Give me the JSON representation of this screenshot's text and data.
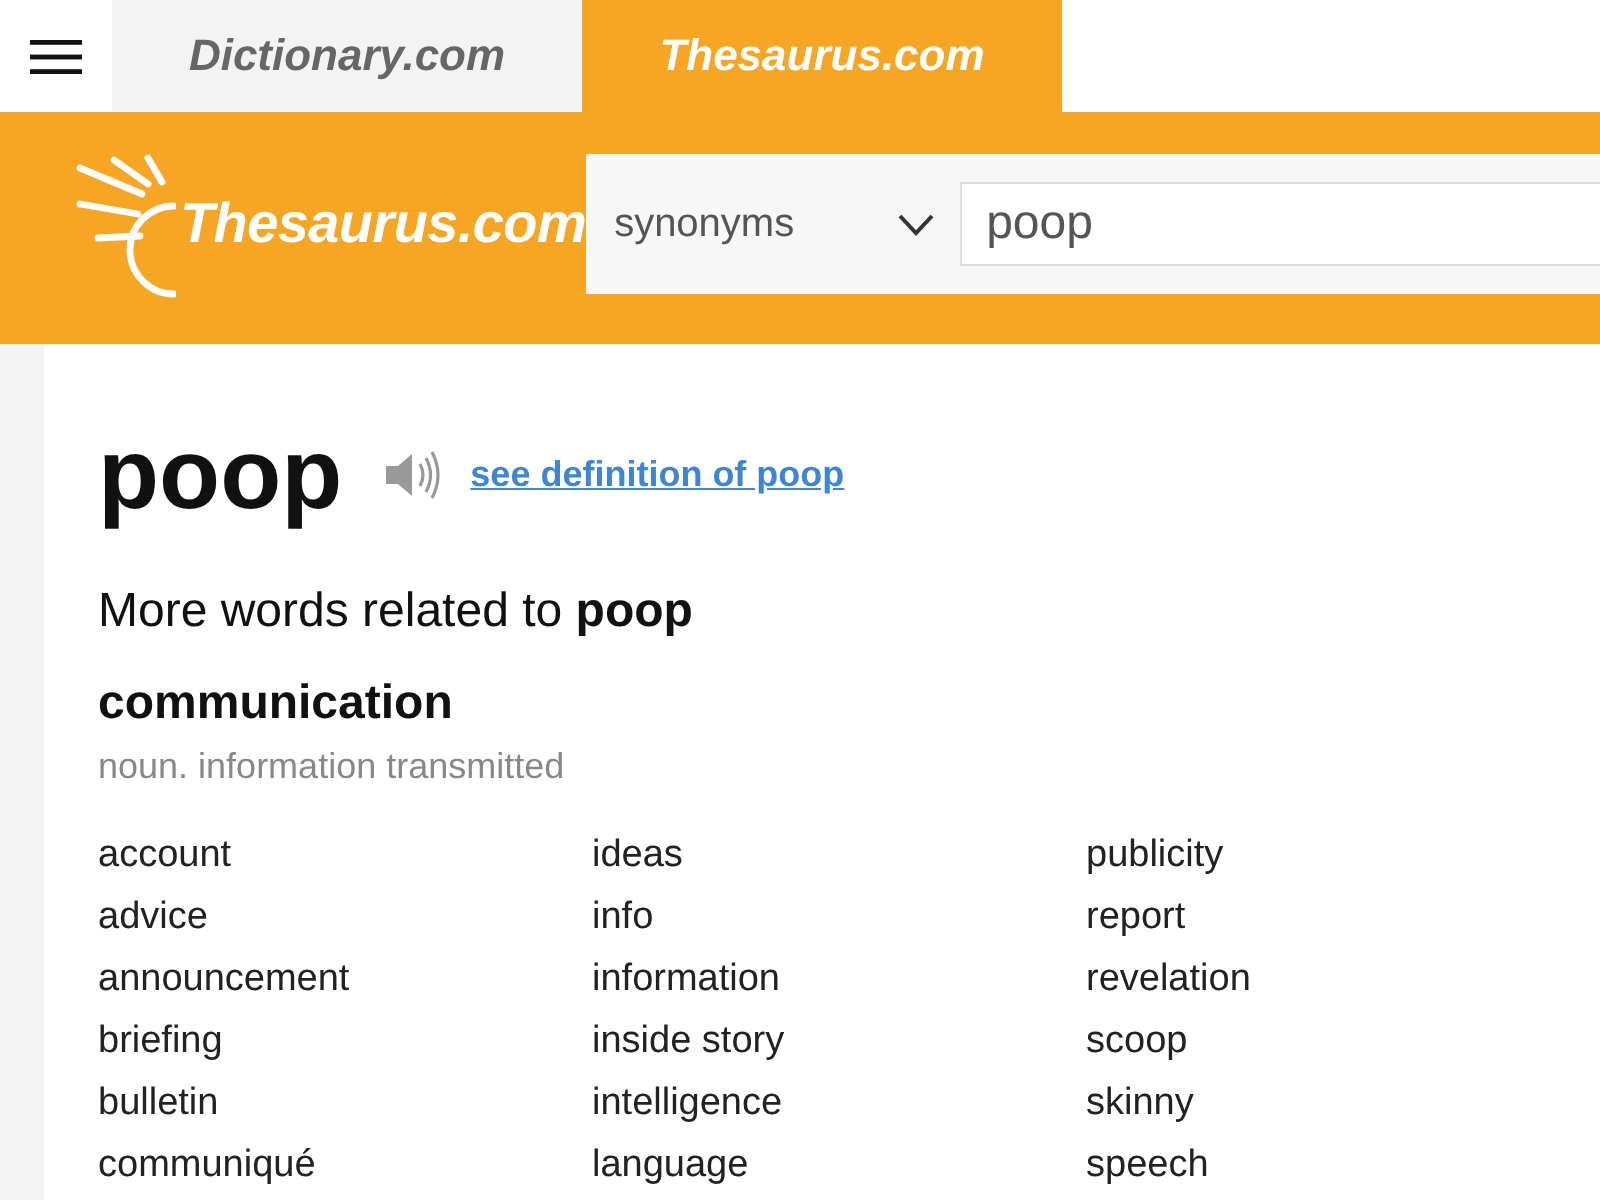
{
  "top_nav": {
    "tabs": [
      {
        "label": "Dictionary.com",
        "selected": false
      },
      {
        "label": "Thesaurus.com",
        "selected": true
      }
    ]
  },
  "header": {
    "logo": "Thesaurus.com",
    "search": {
      "mode": "synonyms",
      "value": "poop"
    }
  },
  "entry": {
    "word": "poop",
    "definition_link": "see definition of poop",
    "related_heading": "More words related to **poop**",
    "senses": [
      {
        "word": "communication",
        "definition": "noun. information transmitted",
        "synonyms": [
          "account",
          "advice",
          "announcement",
          "briefing",
          "bulletin",
          "communiqué",
          "ideas",
          "info",
          "information",
          "inside story",
          "intelligence",
          "language",
          "publicity",
          "report",
          "revelation",
          "scoop",
          "skinny",
          "speech"
        ]
      }
    ]
  }
}
